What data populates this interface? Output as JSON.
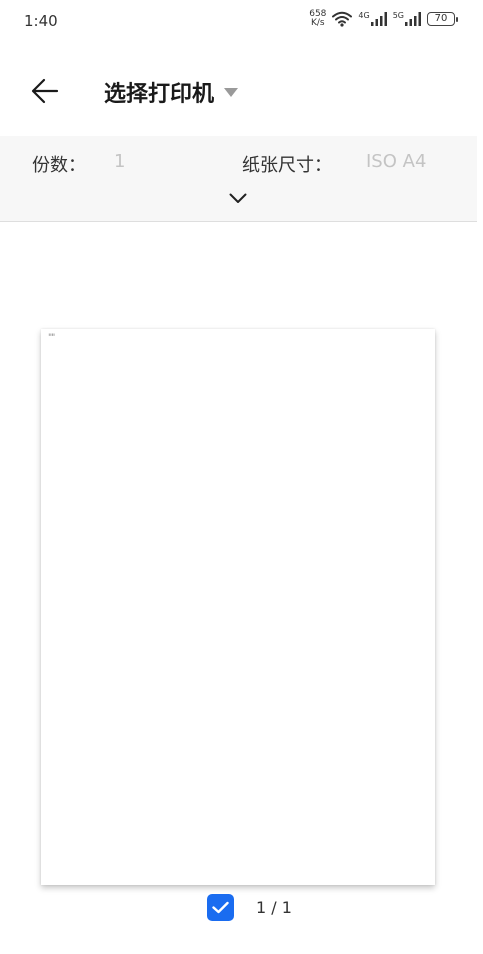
{
  "status_bar": {
    "time": "1:40",
    "net_speed_value": "658",
    "net_speed_unit": "K/s",
    "sim1_tag": "4G",
    "sim2_tag": "5G",
    "battery_level": "70",
    "icons": [
      "wifi-icon",
      "signal-icon",
      "signal-icon",
      "battery-icon"
    ]
  },
  "toolbar": {
    "title": "选择打印机",
    "icons": [
      "back-arrow-icon",
      "dropdown-triangle-icon"
    ]
  },
  "options": {
    "copies_label": "份数：",
    "copies_value": "1",
    "paper_size_label": "纸张尺寸：",
    "paper_size_value": "ISO A4",
    "icons": [
      "chevron-down-icon"
    ]
  },
  "preview": {
    "page_text": "\"\""
  },
  "footer": {
    "page_selected": true,
    "page_counter": "1 / 1",
    "icons": [
      "checkmark-icon"
    ]
  },
  "colors": {
    "accent": "#1a6cf0",
    "panel_background": "#f7f7f7",
    "muted_text": "#c4c4c4"
  }
}
